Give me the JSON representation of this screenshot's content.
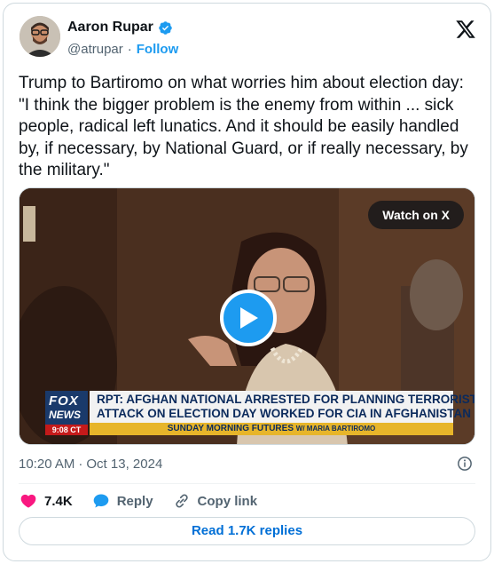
{
  "author": {
    "name": "Aaron Rupar",
    "handle": "@atrupar",
    "separator": "·",
    "follow_label": "Follow"
  },
  "tweet": {
    "text": "Trump to Bartiromo on what worries him about election day: \"I think the bigger problem is the enemy from within ... sick people, radical left lunatics. And it should be easily handled by, if necessary, by National Guard, or if really necessary, by the military.\""
  },
  "media": {
    "watch_label": "Watch on X",
    "chyron": {
      "network_top": "FOX",
      "network_bottom": "NEWS",
      "time": "9:08 CT",
      "headline_line1": "RPT: AFGHAN NATIONAL ARRESTED FOR PLANNING TERRORIST",
      "headline_line2": "ATTACK ON ELECTION DAY WORKED FOR CIA IN AFGHANISTAN",
      "program": "SUNDAY MORNING FUTURES",
      "host": "W/ MARIA BARTIROMO"
    }
  },
  "meta": {
    "time": "10:20 AM",
    "separator": "·",
    "date": "Oct 13, 2024"
  },
  "actions": {
    "likes": "7.4K",
    "reply_label": "Reply",
    "copy_label": "Copy link"
  },
  "replies": {
    "label": "Read 1.7K replies"
  },
  "colors": {
    "accent": "#1d9bf0",
    "like": "#f91880",
    "text_secondary": "#536471",
    "link_blue": "#006fd6"
  },
  "icons": [
    "verified-badge-icon",
    "x-logo-icon",
    "play-icon",
    "info-icon",
    "heart-icon",
    "reply-bubble-icon",
    "link-icon"
  ]
}
